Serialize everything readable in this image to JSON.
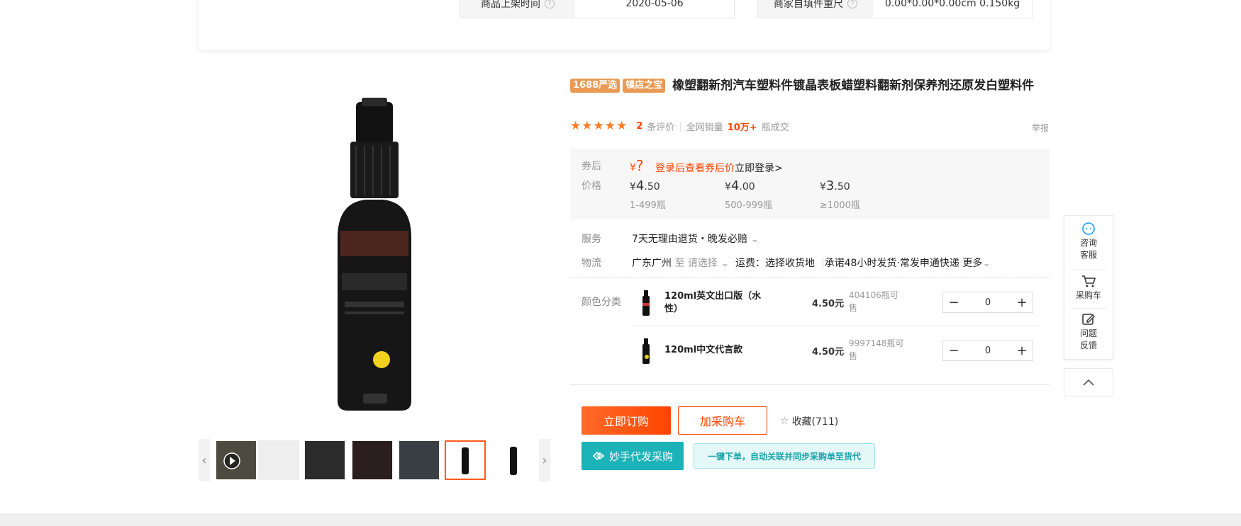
{
  "attributes": [
    {
      "label": "商品上架时间",
      "value": "2020-05-06"
    },
    {
      "label": "商家自填件重尺",
      "value": "0.00*0.00*0.00cm 0.150kg"
    }
  ],
  "product": {
    "tags": [
      "1688严选",
      "镇店之宝"
    ],
    "title": "橡塑翻新剂汽车塑料件镀晶表板蜡塑料翻新剂保养剂还原发白塑料件",
    "rating_stars": 5,
    "review_count": "2",
    "review_label": "条评价",
    "sales_label": "全网销量",
    "sales_value": "10万+",
    "sales_unit": "瓶成交",
    "report_label": "举报"
  },
  "price": {
    "coupon_label": "券后",
    "price_label": "价格",
    "currency": "¥",
    "coupon_unknown": "?",
    "login_tip": "登录后查看券后价",
    "login_link": "立即登录>",
    "tiers": [
      {
        "int": "4",
        "dec": ".50",
        "range": "1-499瓶"
      },
      {
        "int": "4",
        "dec": ".00",
        "range": "500-999瓶"
      },
      {
        "int": "3",
        "dec": ".50",
        "range": "≥1000瓶"
      }
    ]
  },
  "service": {
    "label": "服务",
    "value": "7天无理由退货・晚发必赔"
  },
  "logistics": {
    "label": "物流",
    "from": "广东广州",
    "to_prefix": "至",
    "to_value": "请选择",
    "freight": "运费：选择收货地",
    "promise": "承诺48小时发货·常发申通快递",
    "more": "更多"
  },
  "skus": {
    "label": "颜色分类",
    "items": [
      {
        "name": "120ml英文出口版（水性）",
        "price": "4.50元",
        "stock": "404106瓶可售",
        "qty": "0"
      },
      {
        "name": "120ml中文代言款",
        "price": "4.50元",
        "stock": "9997148瓶可售",
        "qty": "0"
      }
    ]
  },
  "actions": {
    "order": "立即订购",
    "cart": "加采购车",
    "favorite": "收藏(711)",
    "daifa": "妙手代发采购",
    "daifa_tip": "一键下单，自动关联并同步采购单至货代"
  },
  "float": {
    "consult": [
      "咨询",
      "客服"
    ],
    "cart": "采购车",
    "feedback": [
      "问题",
      "反馈"
    ]
  },
  "colors": {
    "accent": "#ff4400",
    "teal": "#1bb2b8"
  }
}
